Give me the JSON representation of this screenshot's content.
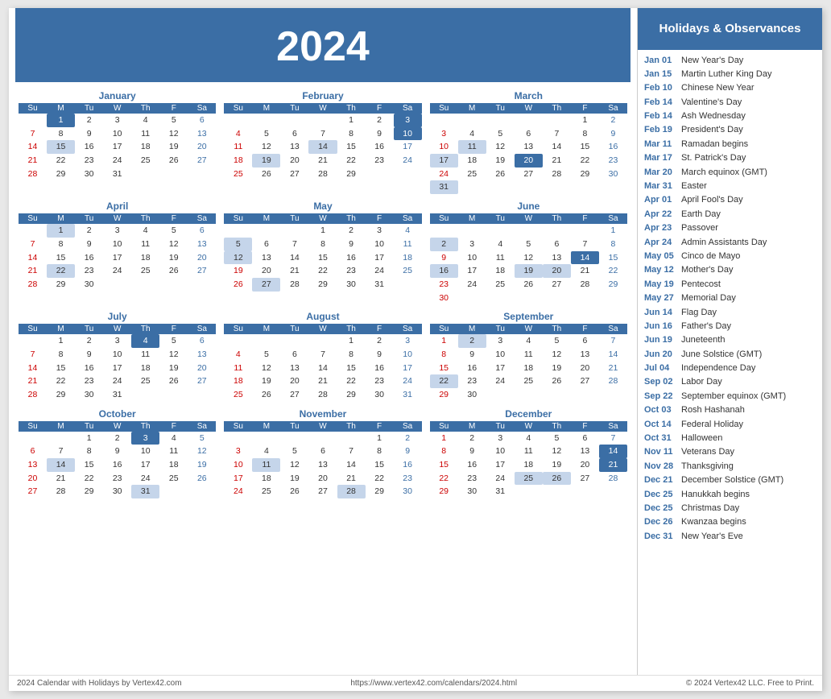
{
  "header": {
    "year": "2024",
    "bg_color": "#3b6ea5"
  },
  "sidebar_title": "Holidays & Observances",
  "holidays": [
    {
      "date": "Jan 01",
      "name": "New Year's Day"
    },
    {
      "date": "Jan 15",
      "name": "Martin Luther King Day"
    },
    {
      "date": "Feb 10",
      "name": "Chinese New Year"
    },
    {
      "date": "Feb 14",
      "name": "Valentine's Day"
    },
    {
      "date": "Feb 14",
      "name": "Ash Wednesday"
    },
    {
      "date": "Feb 19",
      "name": "President's Day"
    },
    {
      "date": "Mar 11",
      "name": "Ramadan begins"
    },
    {
      "date": "Mar 17",
      "name": "St. Patrick's Day"
    },
    {
      "date": "Mar 20",
      "name": "March equinox (GMT)"
    },
    {
      "date": "Mar 31",
      "name": "Easter"
    },
    {
      "date": "Apr 01",
      "name": "April Fool's Day"
    },
    {
      "date": "Apr 22",
      "name": "Earth Day"
    },
    {
      "date": "Apr 23",
      "name": "Passover"
    },
    {
      "date": "Apr 24",
      "name": "Admin Assistants Day"
    },
    {
      "date": "May 05",
      "name": "Cinco de Mayo"
    },
    {
      "date": "May 12",
      "name": "Mother's Day"
    },
    {
      "date": "May 19",
      "name": "Pentecost"
    },
    {
      "date": "May 27",
      "name": "Memorial Day"
    },
    {
      "date": "Jun 14",
      "name": "Flag Day"
    },
    {
      "date": "Jun 16",
      "name": "Father's Day"
    },
    {
      "date": "Jun 19",
      "name": "Juneteenth"
    },
    {
      "date": "Jun 20",
      "name": "June Solstice (GMT)"
    },
    {
      "date": "Jul 04",
      "name": "Independence Day"
    },
    {
      "date": "Sep 02",
      "name": "Labor Day"
    },
    {
      "date": "Sep 22",
      "name": "September equinox (GMT)"
    },
    {
      "date": "Oct 03",
      "name": "Rosh Hashanah"
    },
    {
      "date": "Oct 14",
      "name": "Federal Holiday"
    },
    {
      "date": "Oct 31",
      "name": "Halloween"
    },
    {
      "date": "Nov 11",
      "name": "Veterans Day"
    },
    {
      "date": "Nov 28",
      "name": "Thanksgiving"
    },
    {
      "date": "Dec 21",
      "name": "December Solstice (GMT)"
    },
    {
      "date": "Dec 25",
      "name": "Hanukkah begins"
    },
    {
      "date": "Dec 25",
      "name": "Christmas Day"
    },
    {
      "date": "Dec 26",
      "name": "Kwanzaa begins"
    },
    {
      "date": "Dec 31",
      "name": "New Year's Eve"
    }
  ],
  "footer": {
    "left": "2024 Calendar with Holidays by Vertex42.com",
    "center": "https://www.vertex42.com/calendars/2024.html",
    "right": "© 2024 Vertex42 LLC. Free to Print."
  },
  "months": [
    {
      "name": "January",
      "weeks": [
        [
          null,
          1,
          2,
          3,
          4,
          5,
          6
        ],
        [
          7,
          8,
          9,
          10,
          11,
          12,
          13
        ],
        [
          14,
          15,
          16,
          17,
          18,
          19,
          20
        ],
        [
          21,
          22,
          23,
          24,
          25,
          26,
          27
        ],
        [
          28,
          29,
          30,
          31,
          null,
          null,
          null
        ]
      ],
      "highlights_blue": [
        1
      ],
      "highlights_light": [
        15
      ]
    },
    {
      "name": "February",
      "weeks": [
        [
          null,
          null,
          null,
          null,
          1,
          2,
          3
        ],
        [
          4,
          5,
          6,
          7,
          8,
          9,
          10
        ],
        [
          11,
          12,
          13,
          14,
          15,
          16,
          17
        ],
        [
          18,
          19,
          20,
          21,
          22,
          23,
          24
        ],
        [
          25,
          26,
          27,
          28,
          29,
          null,
          null
        ]
      ],
      "highlights_blue": [
        3,
        10
      ],
      "highlights_light": [
        14,
        19
      ]
    },
    {
      "name": "March",
      "weeks": [
        [
          null,
          null,
          null,
          null,
          null,
          1,
          2
        ],
        [
          3,
          4,
          5,
          6,
          7,
          8,
          9
        ],
        [
          10,
          11,
          12,
          13,
          14,
          15,
          16
        ],
        [
          17,
          18,
          19,
          20,
          21,
          22,
          23
        ],
        [
          24,
          25,
          26,
          27,
          28,
          29,
          30
        ],
        [
          31,
          null,
          null,
          null,
          null,
          null,
          null
        ]
      ],
      "highlights_blue": [
        20
      ],
      "highlights_light": [
        11,
        17,
        31
      ]
    },
    {
      "name": "April",
      "weeks": [
        [
          null,
          1,
          2,
          3,
          4,
          5,
          6
        ],
        [
          7,
          8,
          9,
          10,
          11,
          12,
          13
        ],
        [
          14,
          15,
          16,
          17,
          18,
          19,
          20
        ],
        [
          21,
          22,
          23,
          24,
          25,
          26,
          27
        ],
        [
          28,
          29,
          30,
          null,
          null,
          null,
          null
        ]
      ],
      "highlights_blue": [],
      "highlights_light": [
        1,
        22
      ]
    },
    {
      "name": "May",
      "weeks": [
        [
          null,
          null,
          null,
          1,
          2,
          3,
          4
        ],
        [
          5,
          6,
          7,
          8,
          9,
          10,
          11
        ],
        [
          12,
          13,
          14,
          15,
          16,
          17,
          18
        ],
        [
          19,
          20,
          21,
          22,
          23,
          24,
          25
        ],
        [
          26,
          27,
          28,
          29,
          30,
          31,
          null
        ]
      ],
      "highlights_blue": [],
      "highlights_light": [
        5,
        12,
        27
      ]
    },
    {
      "name": "June",
      "weeks": [
        [
          null,
          null,
          null,
          null,
          null,
          null,
          1
        ],
        [
          2,
          3,
          4,
          5,
          6,
          7,
          8
        ],
        [
          9,
          10,
          11,
          12,
          13,
          14,
          15
        ],
        [
          16,
          17,
          18,
          19,
          20,
          21,
          22
        ],
        [
          23,
          24,
          25,
          26,
          27,
          28,
          29
        ],
        [
          30,
          null,
          null,
          null,
          null,
          null,
          null
        ]
      ],
      "highlights_blue": [
        14
      ],
      "highlights_light": [
        2,
        16,
        19,
        20
      ]
    },
    {
      "name": "July",
      "weeks": [
        [
          null,
          1,
          2,
          3,
          4,
          5,
          6
        ],
        [
          7,
          8,
          9,
          10,
          11,
          12,
          13
        ],
        [
          14,
          15,
          16,
          17,
          18,
          19,
          20
        ],
        [
          21,
          22,
          23,
          24,
          25,
          26,
          27
        ],
        [
          28,
          29,
          30,
          31,
          null,
          null,
          null
        ]
      ],
      "highlights_blue": [
        4
      ],
      "highlights_light": []
    },
    {
      "name": "August",
      "weeks": [
        [
          null,
          null,
          null,
          null,
          1,
          2,
          3
        ],
        [
          4,
          5,
          6,
          7,
          8,
          9,
          10
        ],
        [
          11,
          12,
          13,
          14,
          15,
          16,
          17
        ],
        [
          18,
          19,
          20,
          21,
          22,
          23,
          24
        ],
        [
          25,
          26,
          27,
          28,
          29,
          30,
          31
        ]
      ],
      "highlights_blue": [],
      "highlights_light": []
    },
    {
      "name": "September",
      "weeks": [
        [
          1,
          2,
          3,
          4,
          5,
          6,
          7
        ],
        [
          8,
          9,
          10,
          11,
          12,
          13,
          14
        ],
        [
          15,
          16,
          17,
          18,
          19,
          20,
          21
        ],
        [
          22,
          23,
          24,
          25,
          26,
          27,
          28
        ],
        [
          29,
          30,
          null,
          null,
          null,
          null,
          null
        ]
      ],
      "highlights_blue": [],
      "highlights_light": [
        2,
        22
      ]
    },
    {
      "name": "October",
      "weeks": [
        [
          null,
          null,
          1,
          2,
          3,
          4,
          5
        ],
        [
          6,
          7,
          8,
          9,
          10,
          11,
          12
        ],
        [
          13,
          14,
          15,
          16,
          17,
          18,
          19
        ],
        [
          20,
          21,
          22,
          23,
          24,
          25,
          26
        ],
        [
          27,
          28,
          29,
          30,
          31,
          null,
          null
        ]
      ],
      "highlights_blue": [
        3
      ],
      "highlights_light": [
        14,
        31
      ]
    },
    {
      "name": "November",
      "weeks": [
        [
          null,
          null,
          null,
          null,
          null,
          1,
          2
        ],
        [
          3,
          4,
          5,
          6,
          7,
          8,
          9
        ],
        [
          10,
          11,
          12,
          13,
          14,
          15,
          16
        ],
        [
          17,
          18,
          19,
          20,
          21,
          22,
          23
        ],
        [
          24,
          25,
          26,
          27,
          28,
          29,
          30
        ]
      ],
      "highlights_blue": [],
      "highlights_light": [
        11,
        28
      ]
    },
    {
      "name": "December",
      "weeks": [
        [
          1,
          2,
          3,
          4,
          5,
          6,
          7
        ],
        [
          8,
          9,
          10,
          11,
          12,
          13,
          14
        ],
        [
          15,
          16,
          17,
          18,
          19,
          20,
          21
        ],
        [
          22,
          23,
          24,
          25,
          26,
          27,
          28
        ],
        [
          29,
          30,
          31,
          null,
          null,
          null,
          null
        ]
      ],
      "highlights_blue": [
        14,
        21
      ],
      "highlights_light": [
        25,
        26
      ]
    }
  ]
}
